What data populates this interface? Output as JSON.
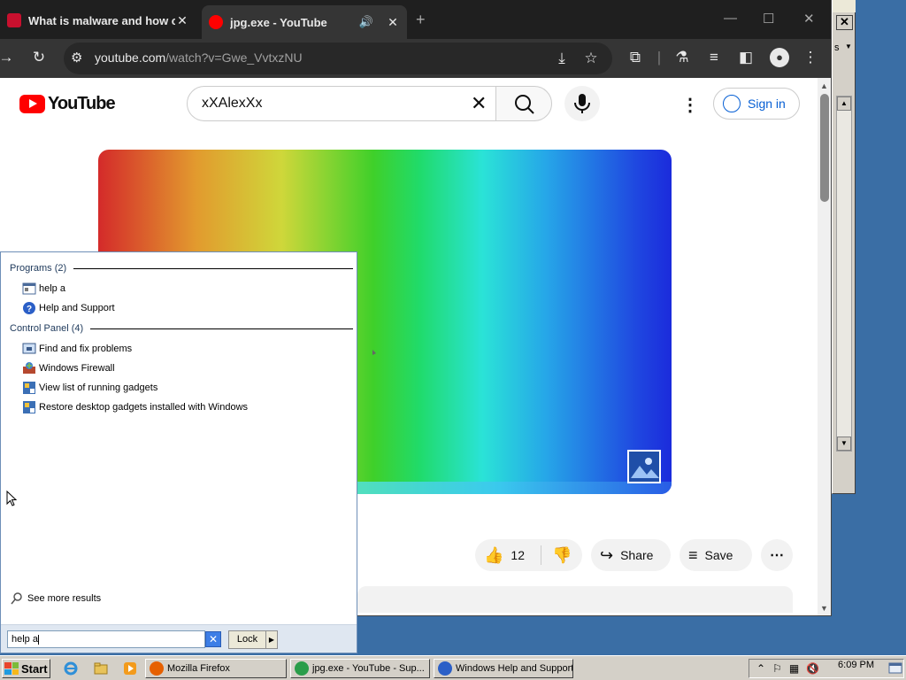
{
  "browser": {
    "tabs": [
      {
        "title": "What is malware and how cybe",
        "active": false,
        "favicon_color": "#c8102e"
      },
      {
        "title": "jpg.exe - YouTube",
        "active": true,
        "favicon_color": "#ff0000"
      }
    ],
    "url_host": "youtube.com",
    "url_rest": "/watch?v=Gwe_VvtxzNU"
  },
  "youtube": {
    "logo_text": "YouTube",
    "search_value": "xXAlexXx",
    "sign_in_label": "Sign in",
    "like_count": "12",
    "share_label": "Share",
    "save_label": "Save"
  },
  "start_menu": {
    "groups": [
      {
        "label": "Programs (2)",
        "items": [
          "help a",
          "Help and Support"
        ]
      },
      {
        "label": "Control Panel (4)",
        "items": [
          "Find and fix problems",
          "Windows Firewall",
          "View list of running gadgets",
          "Restore desktop gadgets installed with Windows"
        ]
      }
    ],
    "see_more_label": "See more results",
    "search_value": "help a",
    "lock_label": "Lock"
  },
  "background_window": {
    "partial_text": "s"
  },
  "taskbar": {
    "start_label": "Start",
    "tasks": [
      {
        "label": "Mozilla Firefox",
        "icon_color": "#e66000"
      },
      {
        "label": "jpg.exe - YouTube - Sup...",
        "icon_color": "#2a9d4a"
      },
      {
        "label": "Windows Help and Support",
        "icon_color": "#2b5fc7"
      }
    ],
    "clock": "6:09 PM"
  },
  "colors": {
    "yt_red": "#ff0000",
    "yt_blue": "#065fd4",
    "chrome_dark": "#1f1f1f",
    "classic_gray": "#d4d0c8",
    "desktop_blue": "#3a6ea5"
  }
}
